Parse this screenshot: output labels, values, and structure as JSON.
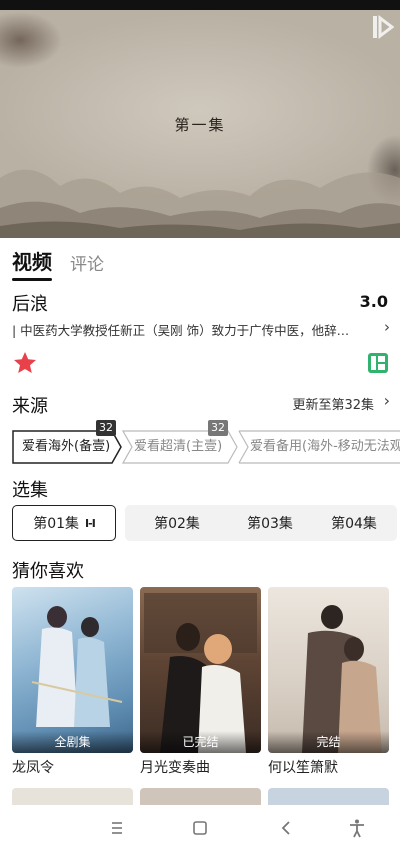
{
  "player": {
    "episode_title": "第一集",
    "logo_icon": "iqiyi-logo-icon"
  },
  "tabs": [
    {
      "label": "视频",
      "active": true
    },
    {
      "label": "评论",
      "active": false
    }
  ],
  "show": {
    "title": "后浪",
    "score": "3.0",
    "synopsis": "| 中医药大学教授任新正（吴刚 饰）致力于广传中医，他辞…",
    "favorite_icon": "star-icon",
    "grid_icon": "grid-app-icon"
  },
  "source": {
    "title": "来源",
    "update": "更新至第32集",
    "chips": [
      {
        "label": "爱看海外(备壹)",
        "badge": "32",
        "active": true
      },
      {
        "label": "爱看超清(主壹)",
        "badge": "32",
        "active": false
      },
      {
        "label": "爱看备用(海外-移动无法观",
        "badge": "",
        "active": false
      }
    ]
  },
  "episodes": {
    "title": "选集",
    "items": [
      {
        "label": "第01集",
        "active": true
      },
      {
        "label": "第02集",
        "active": false
      },
      {
        "label": "第03集",
        "active": false
      },
      {
        "label": "第04集",
        "active": false
      }
    ],
    "playing_indicator": "I-I"
  },
  "recommend": {
    "title": "猜你喜欢",
    "items": [
      {
        "name": "龙凤令",
        "status": "全剧集",
        "color": "#7fa9c9"
      },
      {
        "name": "月光变奏曲",
        "status": "已完结",
        "color": "#6b4c3b"
      },
      {
        "name": "何以笙箫默",
        "status": "完结",
        "color": "#d9cfc5"
      }
    ]
  },
  "nav": {
    "menu_icon": "menu-icon",
    "home_icon": "home-square-icon",
    "back_icon": "back-chevron-icon",
    "accessibility_icon": "accessibility-icon"
  }
}
